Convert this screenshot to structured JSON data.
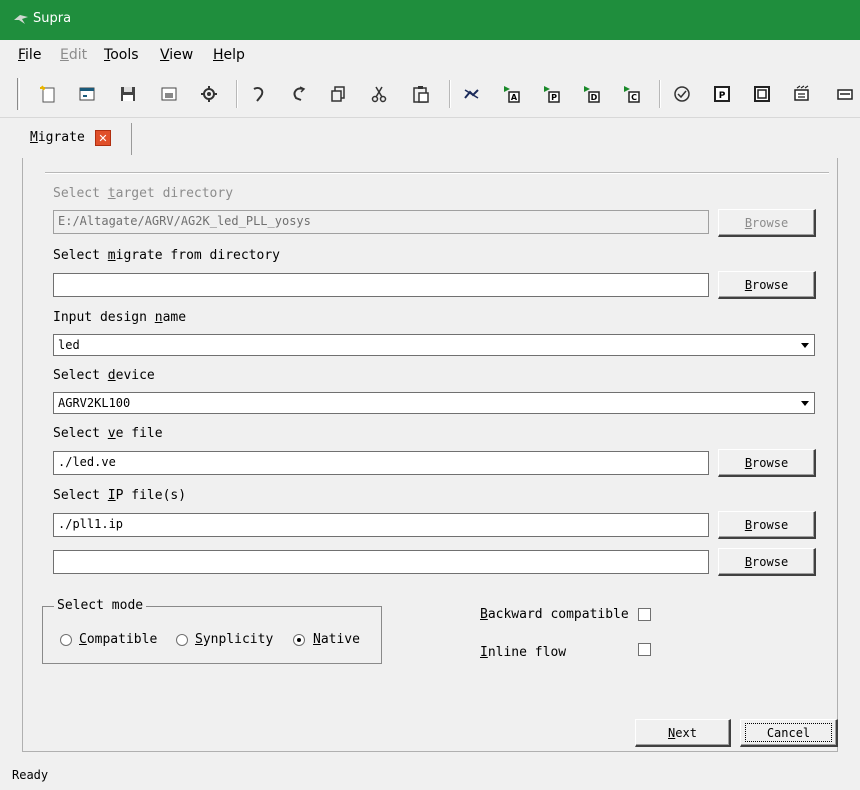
{
  "window": {
    "title": "Supra"
  },
  "menu": [
    {
      "pre": "",
      "key": "F",
      "post": "ile",
      "enabled": true
    },
    {
      "pre": "",
      "key": "E",
      "post": "dit",
      "enabled": false
    },
    {
      "pre": "",
      "key": "T",
      "post": "ools",
      "enabled": true
    },
    {
      "pre": "",
      "key": "V",
      "post": "iew",
      "enabled": true
    },
    {
      "pre": "",
      "key": "H",
      "post": "elp",
      "enabled": true
    }
  ],
  "tab": {
    "pre": "",
    "key": "M",
    "post": "igrate"
  },
  "form": {
    "target_dir": {
      "pre": "Select ",
      "key": "t",
      "post": "arget directory",
      "value": "E:/Altagate/AGRV/AG2K_led_PLL_yosys",
      "enabled": false
    },
    "migrate_from": {
      "pre": "Select ",
      "key": "m",
      "post": "igrate from directory",
      "value": ""
    },
    "design_name": {
      "pre": "Input design ",
      "key": "n",
      "post": "ame",
      "value": "led"
    },
    "device": {
      "pre": "Select ",
      "key": "d",
      "post": "evice",
      "value": "AGRV2KL100"
    },
    "ve_file": {
      "pre": "Select ",
      "key": "v",
      "post": "e file",
      "value": "./led.ve"
    },
    "ip_files": {
      "pre": "Select ",
      "key": "I",
      "post": "P file(s)",
      "values": [
        "./pll1.ip",
        ""
      ]
    },
    "browse": {
      "pre": "",
      "key": "B",
      "post": "rowse"
    },
    "mode": {
      "legend": {
        "pre": "Select m",
        "key": "o",
        "post": "de"
      },
      "options": [
        {
          "pre": "",
          "key": "C",
          "post": "ompatible",
          "checked": false
        },
        {
          "pre": "",
          "key": "S",
          "post": "ynplicity",
          "checked": false
        },
        {
          "pre": "",
          "key": "N",
          "post": "ative",
          "checked": true
        }
      ]
    },
    "backward": {
      "pre": "",
      "key": "B",
      "post": "ackward compatible",
      "checked": false
    },
    "inline": {
      "pre": "",
      "key": "I",
      "post": "nline flow",
      "checked": false
    }
  },
  "buttons": {
    "next": {
      "pre": "",
      "key": "N",
      "post": "ext"
    },
    "cancel": {
      "pre": "",
      "key": "",
      "post": "Cancel"
    }
  },
  "status": {
    "text": "Ready"
  },
  "colors": {
    "titlebar": "#1f8e3d",
    "tab_close": "#e0502a"
  },
  "toolbar_icons": [
    "new-project-icon",
    "open-project-icon",
    "save-icon",
    "save-as-icon",
    "settings-icon",
    "undo-icon",
    "redo-icon",
    "copy-icon",
    "cut-icon",
    "paste-icon",
    "compile-icon",
    "run-a-icon",
    "run-p-icon",
    "run-d-icon",
    "run-c-icon",
    "check-icon",
    "p-panel-icon",
    "d-panel-icon",
    "chip-icon",
    "more-icon"
  ]
}
